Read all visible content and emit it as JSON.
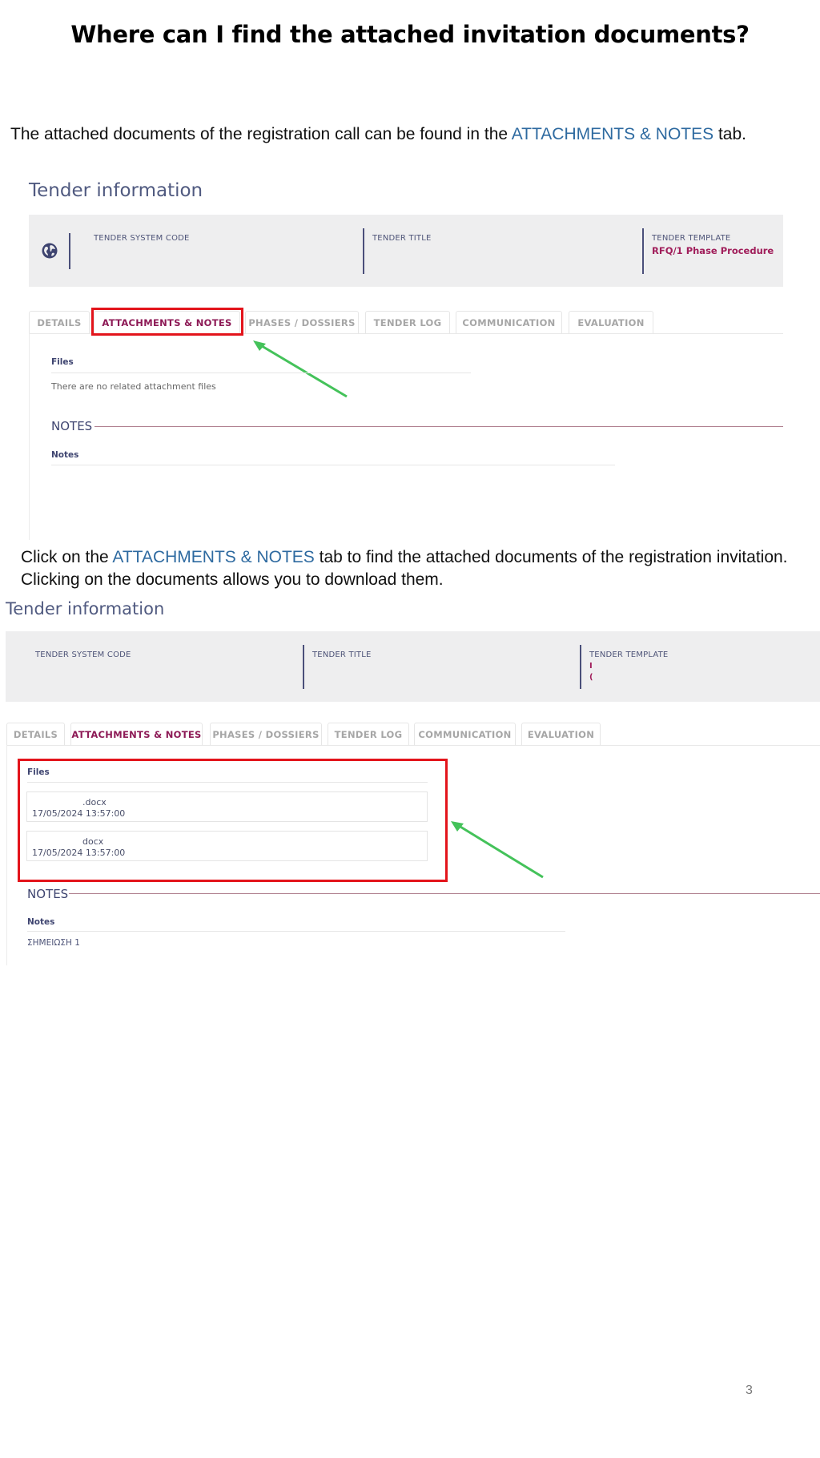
{
  "slide": {
    "title": "Where can I find the attached invitation documents?",
    "intro": {
      "before": "The attached documents of the registration call can be found in the ",
      "highlight": "ATTACHMENTS & NOTES",
      "after": " tab."
    },
    "instruction": {
      "line1_before": "Click on the ",
      "line1_highlight": "ATTACHMENTS & NOTES",
      "line1_after": " tab to find the attached documents of the registration invitation.",
      "line2": "Clicking on the documents allows you to download them."
    },
    "page_number": "3",
    "colors": {
      "highlight": "#2e6aa0",
      "annotation_box": "#e3141b",
      "annotation_arrow": "#44c25a",
      "active_tab": "#8d1a56",
      "template_value": "#a01d5a"
    }
  },
  "screenshot1": {
    "heading": "Tender information",
    "globe_icon": "globe-icon",
    "fields": {
      "system_code_label": "TENDER SYSTEM CODE",
      "title_label": "TENDER TITLE",
      "template_label": "TENDER TEMPLATE",
      "template_value": "RFQ/1 Phase Procedure"
    },
    "tabs": [
      {
        "label": "DETAILS",
        "active": false
      },
      {
        "label": "ATTACHMENTS & NOTES",
        "active": true
      },
      {
        "label": "PHASES / DOSSIERS",
        "active": false
      },
      {
        "label": "TENDER LOG",
        "active": false
      },
      {
        "label": "COMMUNICATION",
        "active": false
      },
      {
        "label": "EVALUATION",
        "active": false
      }
    ],
    "files_label": "Files",
    "no_files_message": "There are no related attachment files",
    "notes_heading": "NOTES",
    "notes_label": "Notes"
  },
  "screenshot2": {
    "heading": "Tender information",
    "fields": {
      "system_code_label": "TENDER SYSTEM CODE",
      "title_label": "TENDER TITLE",
      "template_label": "TENDER TEMPLATE",
      "template_value_line1": "I",
      "template_value_line2": "("
    },
    "tabs": [
      {
        "label": "DETAILS",
        "active": false
      },
      {
        "label": "ATTACHMENTS & NOTES",
        "active": true
      },
      {
        "label": "PHASES / DOSSIERS",
        "active": false
      },
      {
        "label": "TENDER LOG",
        "active": false
      },
      {
        "label": "COMMUNICATION",
        "active": false
      },
      {
        "label": "EVALUATION",
        "active": false
      }
    ],
    "files_label": "Files",
    "files": [
      {
        "name": ".docx",
        "date": "17/05/2024",
        "time": "13:57:00"
      },
      {
        "name": "docx",
        "date": "17/05/2024",
        "time": "13:57:00"
      }
    ],
    "notes_heading": "NOTES",
    "notes_label": "Notes",
    "notes": [
      "ΣΗΜΕΙΩΣΗ 1"
    ]
  }
}
